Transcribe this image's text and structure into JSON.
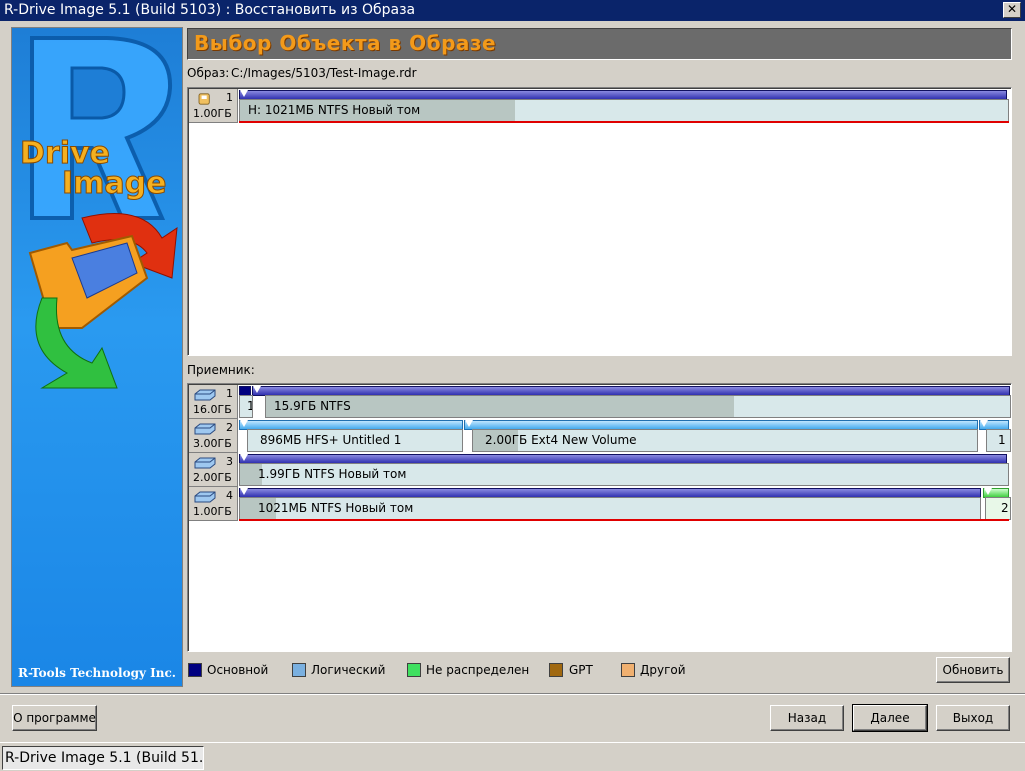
{
  "window": {
    "title": "R-Drive Image 5.1 (Build 5103) : Восстановить из Образа",
    "close_glyph": "✕"
  },
  "banner": {
    "logo_line1": "Drive",
    "logo_line2": "Image",
    "company": "R-Tools Technology Inc."
  },
  "header": {
    "title": "Выбор Объекта в Образе"
  },
  "image_info": {
    "label": "Образ:",
    "path": "C:/Images/5103/Test-Image.rdr"
  },
  "source_disks": [
    {
      "num": "1",
      "size": "1.00ГБ",
      "partitions": [
        {
          "text": "H:  1021МБ  NTFS  Новый том",
          "selected": true
        }
      ]
    }
  ],
  "target_label": "Приемник:",
  "target_disks": [
    {
      "num": "1",
      "size": "16.0ГБ",
      "partitions": [
        {
          "text": "1"
        },
        {
          "text": "15.9ГБ  NTFS"
        }
      ]
    },
    {
      "num": "2",
      "size": "3.00ГБ",
      "partitions": [
        {
          "text": "896МБ  HFS+  Untitled 1"
        },
        {
          "text": "2.00ГБ  Ext4  New Volume"
        },
        {
          "text": "1"
        }
      ]
    },
    {
      "num": "3",
      "size": "2.00ГБ",
      "partitions": [
        {
          "text": "1.99ГБ  NTFS  Новый том"
        }
      ]
    },
    {
      "num": "4",
      "size": "1.00ГБ",
      "partitions": [
        {
          "text": "1021МБ  NTFS  Новый том",
          "selected": true
        },
        {
          "text": "2"
        }
      ]
    }
  ],
  "legend": [
    {
      "label": "Основной",
      "color": "#000080"
    },
    {
      "label": "Логический",
      "color": "#7ab0e0"
    },
    {
      "label": "Не распределен",
      "color": "#40e060"
    },
    {
      "label": "GPT",
      "color": "#a06810"
    },
    {
      "label": "Другой",
      "color": "#f0b070"
    }
  ],
  "buttons": {
    "refresh": "Обновить",
    "about": "О программе",
    "back": "Назад",
    "next": "Далее",
    "exit": "Выход"
  },
  "taskbar": {
    "item": "R-Drive Image 5.1 (Build 51..."
  }
}
